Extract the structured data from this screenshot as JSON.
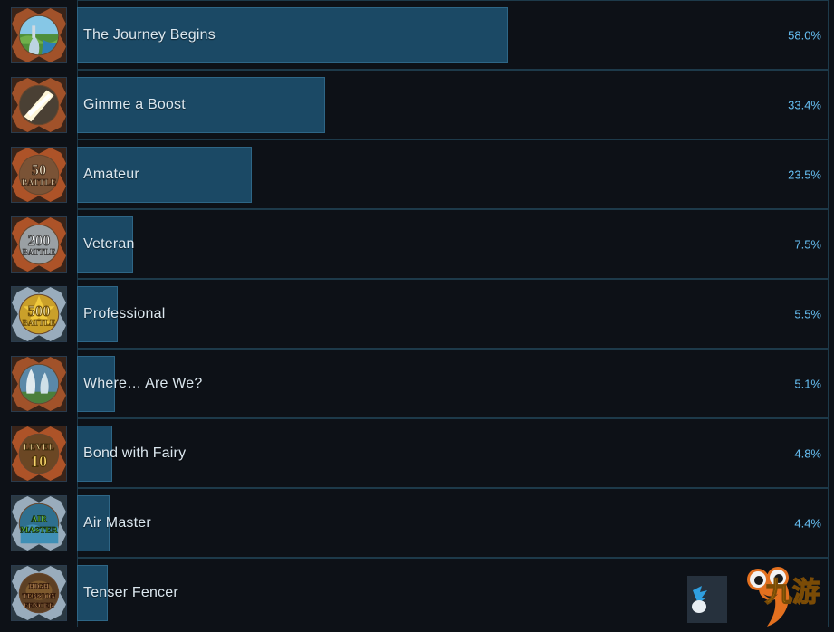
{
  "colors": {
    "page_background": "#0d1117",
    "row_border": "#1d3a4a",
    "bar_fill": "#1b4965",
    "bar_fill_border": "#2e6686",
    "name_text": "#dbe7ef",
    "percent_text": "#67c1f5"
  },
  "achievements": [
    {
      "name": "The Journey Begins",
      "percent_label": "58.0%",
      "percent_value": 58.0,
      "icon_name": "journey-begins-landscape-icon",
      "icon_caption": ""
    },
    {
      "name": "Gimme a Boost",
      "percent_label": "33.4%",
      "percent_value": 33.4,
      "icon_name": "gimme-a-boost-energy-icon",
      "icon_caption": ""
    },
    {
      "name": "Amateur",
      "percent_label": "23.5%",
      "percent_value": 23.5,
      "icon_name": "amateur-50-battle-badge-icon",
      "icon_caption": "50 BATTLE"
    },
    {
      "name": "Veteran",
      "percent_label": "7.5%",
      "percent_value": 7.5,
      "icon_name": "veteran-200-battle-badge-icon",
      "icon_caption": "200 BATTLE"
    },
    {
      "name": "Professional",
      "percent_label": "5.5%",
      "percent_value": 5.5,
      "icon_name": "professional-500-battle-badge-icon",
      "icon_caption": "500 BATTLE"
    },
    {
      "name": "Where… Are We?",
      "percent_label": "5.1%",
      "percent_value": 5.1,
      "icon_name": "where-are-we-forest-icon",
      "icon_caption": ""
    },
    {
      "name": "Bond with Fairy",
      "percent_label": "4.8%",
      "percent_value": 4.8,
      "icon_name": "bond-with-fairy-level-10-badge-icon",
      "icon_caption": "LEVEL 10"
    },
    {
      "name": "Air Master",
      "percent_label": "4.4%",
      "percent_value": 4.4,
      "icon_name": "air-master-badge-icon",
      "icon_caption": "AIR MASTER"
    },
    {
      "name": "Tenser Fencer",
      "percent_label": "",
      "percent_value": 4.1,
      "icon_name": "tenser-fencer-high-tension-badge-icon",
      "icon_caption": "HIGH TENSION FENCER"
    }
  ],
  "watermark": {
    "text": "九游",
    "name": "jiuyou-watermark"
  }
}
